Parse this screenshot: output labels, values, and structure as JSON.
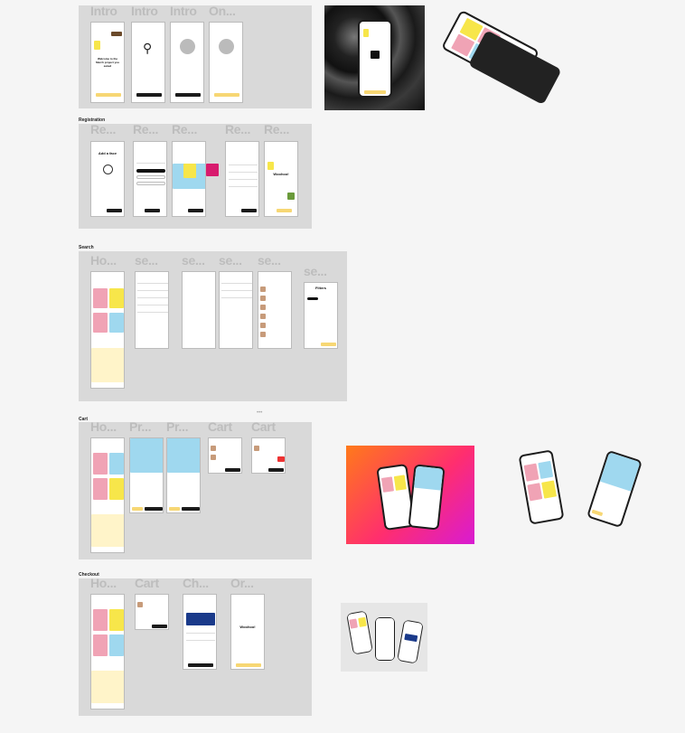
{
  "sections": {
    "intro": {
      "frames": [
        "Intro",
        "Intro",
        "Intro",
        "On..."
      ]
    },
    "registration": {
      "label": "Registration",
      "frames": [
        "Re...",
        "Re...",
        "Re...",
        "Re...",
        "Re..."
      ]
    },
    "search": {
      "label": "Search",
      "frames": [
        "Ho...",
        "se...",
        "se...",
        "se...",
        "se...",
        "se..."
      ]
    },
    "cart": {
      "label": "Cart",
      "frames": [
        "Ho...",
        "Pr...",
        "Pr...",
        "Cart",
        "Cart"
      ]
    },
    "checkout": {
      "label": "Checkout",
      "frames": [
        "Ho...",
        "Cart",
        "Ch...",
        "Or..."
      ]
    }
  },
  "screens": {
    "intro_welcome": "Welcome to the Merch project you asked",
    "intro_btn": "Next",
    "reg_title": "Add a face",
    "woohoo": "Woohoo!",
    "filters": "Filters"
  },
  "colors": {
    "pink": "#f0a3b5",
    "yellow": "#f7e64a",
    "blue": "#9fd8ef",
    "cream": "#fff4c9",
    "button_yellow": "#f7d774"
  }
}
